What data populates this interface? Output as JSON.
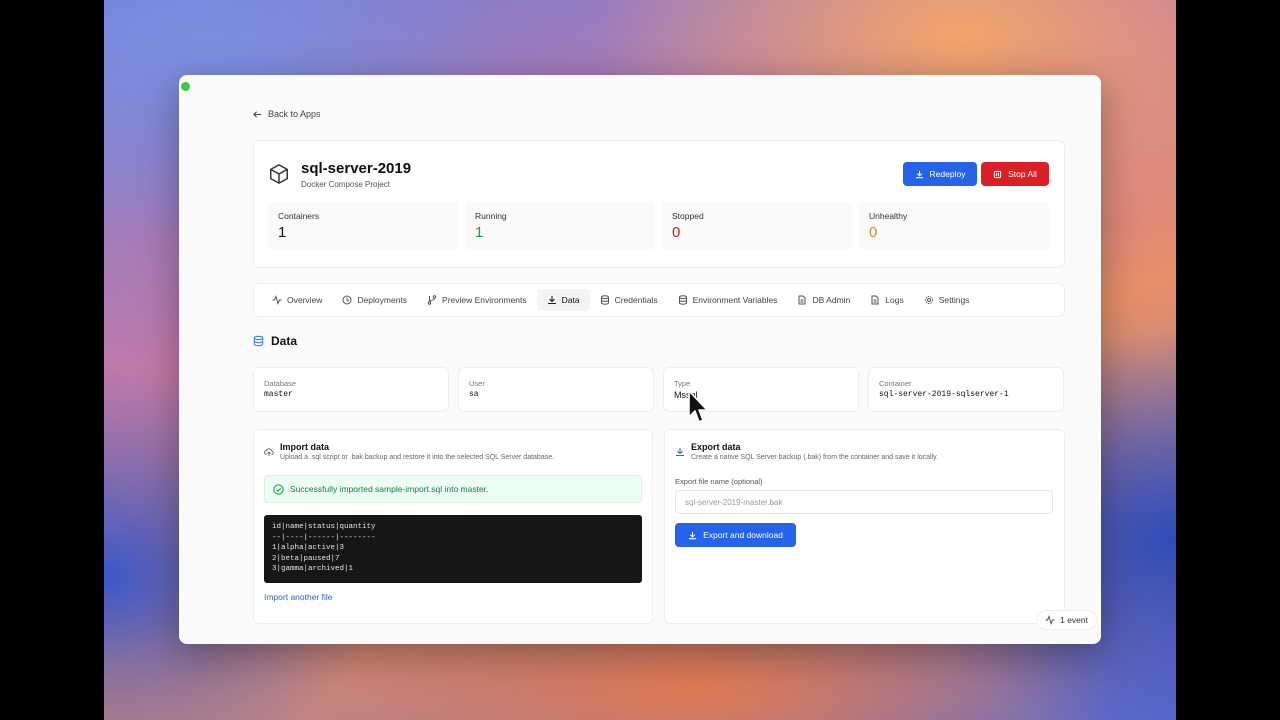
{
  "header": {
    "back_label": "Back to Apps",
    "title": "sql-server-2019",
    "subtitle": "Docker Compose Project",
    "redeploy_label": "Redeploy",
    "stop_label": "Stop All"
  },
  "stats": [
    {
      "label": "Containers",
      "value": "1",
      "color": "#111111"
    },
    {
      "label": "Running",
      "value": "1",
      "color": "#1f9d45"
    },
    {
      "label": "Stopped",
      "value": "0",
      "color": "#c81e1e"
    },
    {
      "label": "Unhealthy",
      "value": "0",
      "color": "#c59312"
    }
  ],
  "tabs": [
    {
      "label": "Overview",
      "icon": "activity-icon",
      "active": false
    },
    {
      "label": "Deployments",
      "icon": "clock-icon",
      "active": false
    },
    {
      "label": "Preview Environments",
      "icon": "git-branch-icon",
      "active": false
    },
    {
      "label": "Data",
      "icon": "download-icon",
      "active": true
    },
    {
      "label": "Credentials",
      "icon": "database-icon",
      "active": false
    },
    {
      "label": "Environment Variables",
      "icon": "database-icon",
      "active": false
    },
    {
      "label": "DB Admin",
      "icon": "file-icon",
      "active": false
    },
    {
      "label": "Logs",
      "icon": "file-icon",
      "active": false
    },
    {
      "label": "Settings",
      "icon": "gear-icon",
      "active": false
    }
  ],
  "section": {
    "title": "Data"
  },
  "info": {
    "database": {
      "label": "Database",
      "value": "master"
    },
    "user": {
      "label": "User",
      "value": "sa"
    },
    "type": {
      "label": "Type",
      "value": "Mssql"
    },
    "container": {
      "label": "Container",
      "value": "sql-server-2019-sqlserver-1"
    }
  },
  "import": {
    "title": "Import data",
    "description": "Upload a .sql script or .bak backup and restore it into the selected SQL Server database.",
    "success_message": "Successfully imported sample-import.sql into master.",
    "output": "id|name|status|quantity\n--|----|------|--------\n1|alpha|active|3\n2|beta|paused|7\n3|gamma|archived|1",
    "link_label": "Import another file"
  },
  "export": {
    "title": "Export data",
    "description": "Create a native SQL Server backup (.bak) from the container and save it locally.",
    "field_label": "Export file name (optional)",
    "field_placeholder": "sql-server-2019-master.bak",
    "button_label": "Export and download"
  },
  "events": {
    "label": "1 event"
  }
}
